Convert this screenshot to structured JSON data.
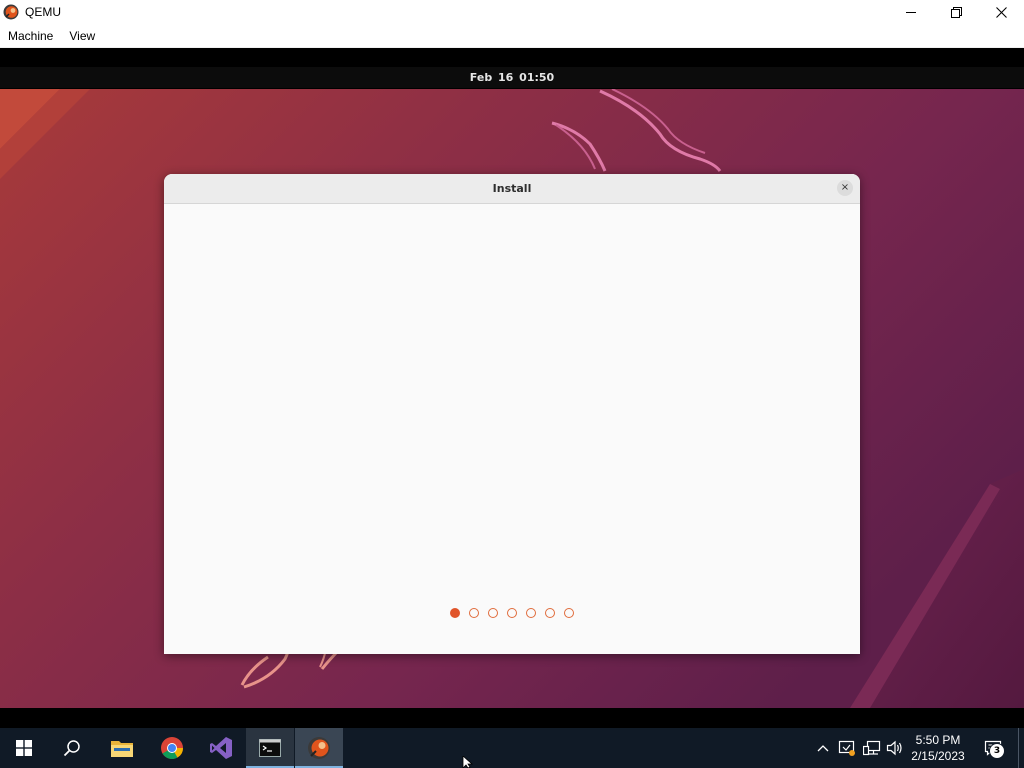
{
  "window": {
    "title": "QEMU",
    "menu": [
      "Machine",
      "View"
    ],
    "controls": [
      "minimize-icon",
      "restore-icon",
      "close-icon"
    ]
  },
  "guest": {
    "topbar_clock": "Feb 16  01:50",
    "dialog": {
      "title": "Install",
      "close_label": "×",
      "steps_total": 7,
      "current_step": 1
    }
  },
  "taskbar": {
    "pinned": [
      "windows-start-icon",
      "search-icon",
      "file-explorer-icon",
      "chrome-icon",
      "visual-studio-icon",
      "terminal-icon",
      "qemu-icon"
    ],
    "clock_time": "5:50 PM",
    "clock_date": "2/15/2023",
    "notification_count": "3"
  },
  "colors": {
    "accent": "#e0542a",
    "taskbar_bg": "#101a26",
    "dialog_bg": "#fafafa"
  }
}
